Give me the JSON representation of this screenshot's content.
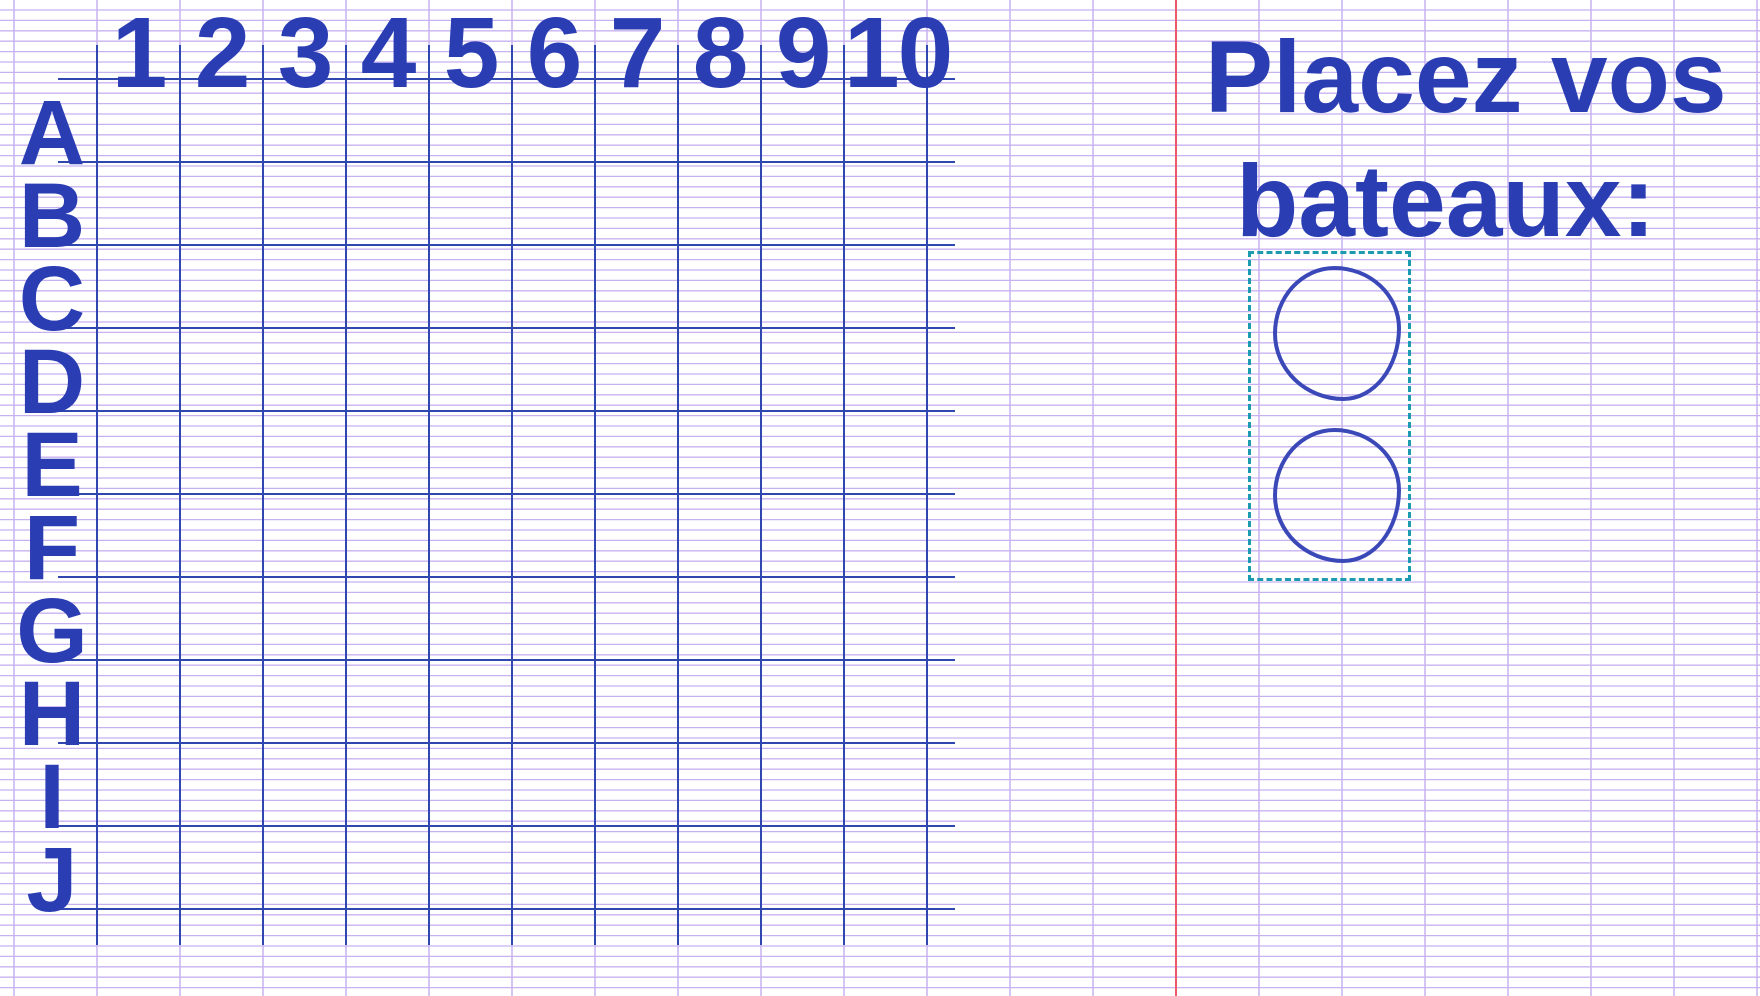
{
  "board": {
    "columns": [
      "1",
      "2",
      "3",
      "4",
      "5",
      "6",
      "7",
      "8",
      "9",
      "10"
    ],
    "rows": [
      "A",
      "B",
      "C",
      "D",
      "E",
      "F",
      "G",
      "H",
      "I",
      "J"
    ]
  },
  "side_panel": {
    "title_line1": "Placez vos",
    "title_line2": "bateaux:",
    "tray_pegs": 2
  },
  "colors": {
    "ink": "#2a3db3",
    "grid_line": "#3047b0",
    "ruling": "#c7b2f0",
    "margin_line": "#e85a6a",
    "tray_border": "#1c9bb0"
  }
}
